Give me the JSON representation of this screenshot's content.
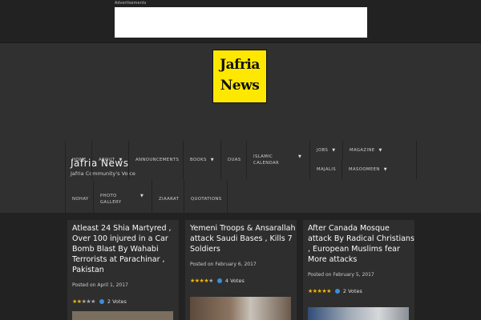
{
  "ad": {
    "label": "Advertisements"
  },
  "logo": {
    "line1": "Jafria",
    "line2": "News"
  },
  "site": {
    "title": "Jafria News",
    "tagline": "Jafria Community's Voice"
  },
  "nav": {
    "home": "HOME",
    "about": "ABOUT",
    "announcements": "ANNOUNCEMENTS",
    "books": "BOOKS",
    "duas": "DUAS",
    "islamic_line1": "ISLAMIC",
    "islamic_line2": "CALENDAR",
    "jobs": "JOBS",
    "magazine": "MAGAZINE",
    "majalis": "MAJALIS",
    "masoomeen": "MASOOMEEN",
    "nohay": "NOHAY",
    "photo_line1": "PHOTO",
    "photo_line2": "GALLERY",
    "ziaraat": "ZIAARAT",
    "quotations": "QUOTATIONS",
    "caret": "▼"
  },
  "posts": [
    {
      "title": "Atleast 24 Shia Martyred , Over 100 injured in a Car Bomb Blast By Wahabi Terrorists at Parachinar , Pakistan",
      "date": "Posted on April 1, 2017",
      "stars_full": "★★",
      "stars_empty": "★★★",
      "votes": "2 Votes"
    },
    {
      "title": "Yemeni Troops & Ansarallah attack Saudi Bases , Kills 7 Soldiers",
      "date": "Posted on February 6, 2017",
      "stars_full": "★★★★",
      "stars_empty": "★",
      "votes": "4 Votes"
    },
    {
      "title": "After Canada Mosque attack By Radical Christians , European Muslims fear More attacks",
      "date": "Posted on February 5, 2017",
      "stars_full": "★★★★★",
      "stars_empty": "",
      "votes": "2 Votes"
    }
  ],
  "colors": {
    "background": "#2b2b2b",
    "header": "#303030",
    "logo_bg": "#ffe800",
    "star": "#f5b800",
    "info": "#3b8fd8"
  }
}
